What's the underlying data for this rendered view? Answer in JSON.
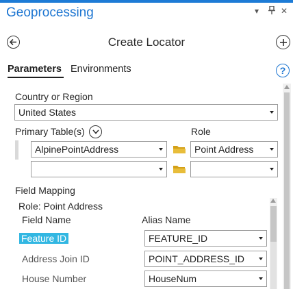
{
  "pane": {
    "title": "Geoprocessing",
    "pin": "▾  ⊡  ✕"
  },
  "tool": {
    "title": "Create Locator",
    "back": "←",
    "add": "+"
  },
  "tabs": [
    {
      "label": "Parameters",
      "active": true
    },
    {
      "label": "Environments",
      "active": false
    }
  ],
  "help": "?",
  "country": {
    "label": "Country or Region",
    "value": "United States"
  },
  "primary": {
    "label": "Primary Table(s)",
    "expand": "⌄",
    "role_label": "Role",
    "rows": [
      {
        "table": "AlpinePointAddress",
        "role": "Point Address"
      },
      {
        "table": "",
        "role": ""
      }
    ]
  },
  "field_mapping": {
    "label": "Field Mapping",
    "role_caption": "Role: Point Address",
    "col_field": "Field Name",
    "col_alias": "Alias Name",
    "rows": [
      {
        "field": "Feature ID",
        "alias": "FEATURE_ID",
        "selected": true
      },
      {
        "field": "Address Join ID",
        "alias": "POINT_ADDRESS_ID",
        "selected": false
      },
      {
        "field": "House Number",
        "alias": "HouseNum",
        "selected": false
      }
    ]
  },
  "colors": {
    "accent": "#1c75d1",
    "highlight": "#32b7e2",
    "folder": "#d4a017"
  }
}
